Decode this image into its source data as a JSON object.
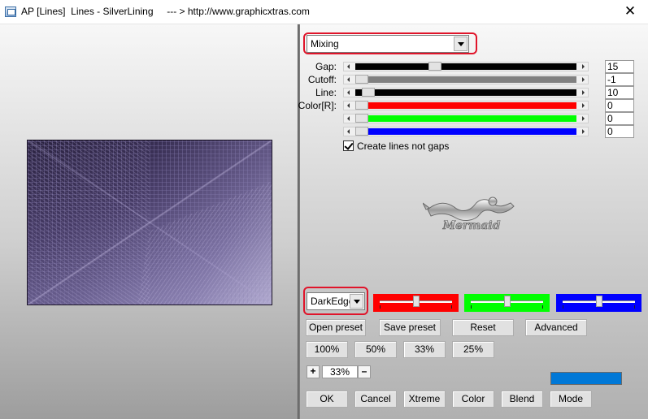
{
  "window": {
    "title": "AP [Lines]  Lines - SilverLining     --- > http://www.graphicxtras.com",
    "close_glyph": "✕"
  },
  "controls": {
    "mode_dropdown": "Mixing",
    "sliders": [
      {
        "label": "Gap:",
        "value": "15",
        "fraction": 0.35,
        "track_color": "#000000"
      },
      {
        "label": "Cutoff:",
        "value": "-1",
        "fraction": 0.0,
        "track_color": "#808080"
      },
      {
        "label": "Line:",
        "value": "10",
        "fraction": 0.03,
        "track_color": "#000000"
      },
      {
        "label": "Color[R]:",
        "value": "0",
        "fraction": 0.0,
        "track_color": "#ff0000"
      },
      {
        "label": "",
        "value": "0",
        "fraction": 0.0,
        "track_color": "#00ff00"
      },
      {
        "label": "",
        "value": "0",
        "fraction": 0.0,
        "track_color": "#0000ff"
      }
    ],
    "checkbox_label": "Create lines not gaps",
    "checkbox_checked": true
  },
  "logo_text": "Mermaid",
  "edge_dropdown": "DarkEdge",
  "color_sliders": [
    {
      "color": "#ff0000",
      "fraction": 0.5
    },
    {
      "color": "#00ff00",
      "fraction": 0.5
    },
    {
      "color": "#0000ff",
      "fraction": 0.5
    }
  ],
  "buttons": {
    "open_preset": "Open preset",
    "save_preset": "Save preset",
    "reset": "Reset",
    "advanced": "Advanced",
    "zoom_100": "100%",
    "zoom_50": "50%",
    "zoom_33": "33%",
    "zoom_25": "25%",
    "plus": "+",
    "minus": "–",
    "ok": "OK",
    "cancel": "Cancel",
    "xtreme": "Xtreme",
    "color": "Color",
    "blend": "Blend",
    "mode": "Mode"
  },
  "zoom_value": "33%",
  "swatch_color": "#0078d7"
}
